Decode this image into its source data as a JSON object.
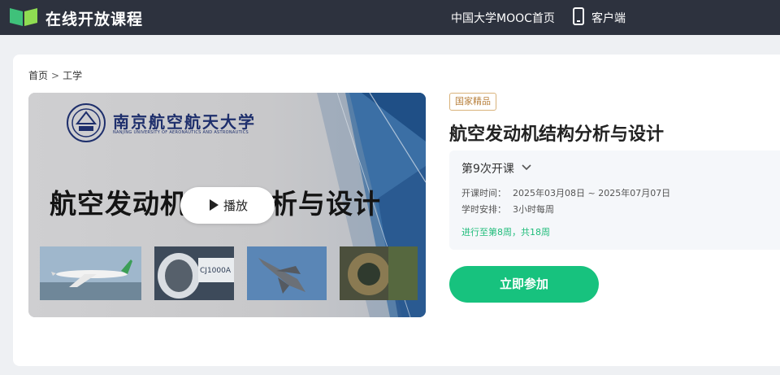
{
  "header": {
    "logo_text": "在线开放课程",
    "nav_mooc": "中国大学MOOC首页",
    "nav_client": "客户端"
  },
  "breadcrumb": {
    "home": "首页",
    "separator": ">",
    "category": "工学"
  },
  "video": {
    "university_name": "南京航空航天大学",
    "university_subtitle": "NANJING UNIVERSITY OF AERONAUTICS AND ASTRONAUTICS",
    "slide_title": "航空发动机结构分析与设计",
    "play_label": "播放"
  },
  "course": {
    "badge": "国家精品",
    "title": "航空发动机结构分析与设计",
    "term_label": "第9次开课",
    "time_label": "开课时间：",
    "time_value": "2025年03月08日 ~ 2025年07月07日",
    "schedule_label": "学时安排：",
    "schedule_value": "3小时每周",
    "progress_text": "进行至第8周，共18周",
    "join_label": "立即参加"
  },
  "colors": {
    "topbar": "#2d323e",
    "accent_green": "#17c27e",
    "badge_gold": "#b8803c",
    "logo_green": "#3fc17a"
  },
  "icons": {
    "logo": "open-book-icon",
    "client": "mobile-phone-icon",
    "term_dropdown": "chevron-down-icon",
    "play": "play-icon"
  }
}
